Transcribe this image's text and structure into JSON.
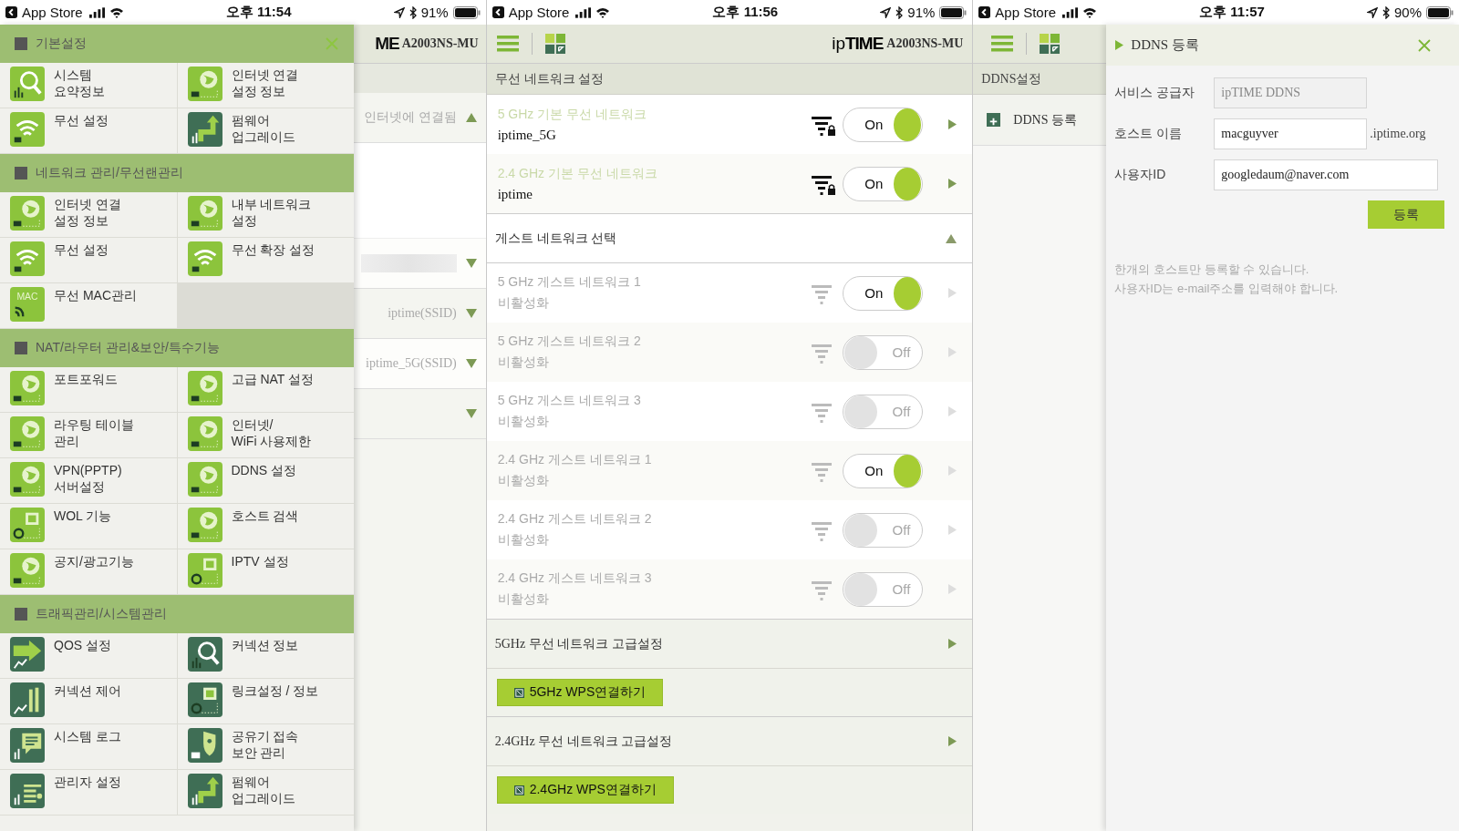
{
  "screens": [
    {
      "kind": "menu",
      "status_bar": {
        "back_label": "App Store",
        "time": "오후 11:54",
        "battery": "91%"
      },
      "background_page": {
        "logo": "ME",
        "model": "A2003NS-MU",
        "rows": [
          {
            "text": "인터넷에 연결됨",
            "redacted": false,
            "expanded": true
          },
          {
            "redacted": true,
            "expanded": false
          },
          {
            "text": "iptime(SSID)",
            "redacted": false,
            "expanded": false
          },
          {
            "text": "iptime_5G(SSID)",
            "redacted": false,
            "expanded": false
          },
          {
            "redacted": false,
            "expanded": false
          }
        ]
      },
      "menu": {
        "sections": [
          {
            "title": "기본설정",
            "closable": true,
            "items": [
              {
                "label": "시스템\n요약정보"
              },
              {
                "label": "인터넷 연결\n설정 정보"
              },
              {
                "label": "무선 설정"
              },
              {
                "label": "펌웨어\n업그레이드"
              }
            ]
          },
          {
            "title": "네트워크 관리/무선랜관리",
            "closable": false,
            "items": [
              {
                "label": "인터넷 연결\n설정 정보"
              },
              {
                "label": "내부 네트워크\n설정"
              },
              {
                "label": "무선 설정"
              },
              {
                "label": "무선 확장 설정"
              },
              {
                "label": "무선 MAC관리",
                "icon_text": "MAC"
              }
            ]
          },
          {
            "title": "NAT/라우터 관리&보안/특수기능",
            "closable": false,
            "items": [
              {
                "label": "포트포워드"
              },
              {
                "label": "고급 NAT 설정"
              },
              {
                "label": "라우팅 테이블\n관리"
              },
              {
                "label": "인터넷/\nWiFi 사용제한"
              },
              {
                "label": "VPN(PPTP)\n서버설정"
              },
              {
                "label": "DDNS 설정"
              },
              {
                "label": "WOL 기능"
              },
              {
                "label": "호스트 검색"
              },
              {
                "label": "공지/광고기능"
              },
              {
                "label": "IPTV 설정"
              }
            ]
          },
          {
            "title": "트래픽관리/시스템관리",
            "closable": false,
            "items": [
              {
                "label": "QOS 설정"
              },
              {
                "label": "커넥션 정보"
              },
              {
                "label": "커넥션 제어"
              },
              {
                "label": "링크설정 / 정보"
              },
              {
                "label": "시스템 로그"
              },
              {
                "label": "공유기 접속\n보안 관리"
              },
              {
                "label": "관리자 설정"
              },
              {
                "label": "펌웨어\n업그레이드"
              }
            ]
          }
        ]
      }
    },
    {
      "kind": "wireless",
      "status_bar": {
        "back_label": "App Store",
        "time": "오후 11:56",
        "battery": "91%"
      },
      "header": {
        "logo_light": "ip",
        "logo_bold": "TIME",
        "model": "A2003NS-MU"
      },
      "section_title": "무선 네트워크 설정",
      "networks": [
        {
          "title": "5 GHz 기본 무선 네트워크",
          "status": "iptime_5G",
          "active": true,
          "on": true,
          "toggle_label": "On"
        },
        {
          "title": "2.4 GHz 기본 무선 네트워크",
          "status": "iptime",
          "active": true,
          "on": true,
          "toggle_label": "On"
        }
      ],
      "guest_header": {
        "title": "게스트 네트워크 선택",
        "expanded": true
      },
      "guest_networks": [
        {
          "title": "5 GHz 게스트 네트워크 1",
          "status": "비활성화",
          "active": false,
          "on": true,
          "toggle_label": "On"
        },
        {
          "title": "5 GHz 게스트 네트워크 2",
          "status": "비활성화",
          "active": false,
          "on": false,
          "toggle_label": "Off"
        },
        {
          "title": "5 GHz 게스트 네트워크 3",
          "status": "비활성화",
          "active": false,
          "on": false,
          "toggle_label": "Off"
        },
        {
          "title": "2.4 GHz 게스트 네트워크 1",
          "status": "비활성화",
          "active": false,
          "on": true,
          "toggle_label": "On"
        },
        {
          "title": "2.4 GHz 게스트 네트워크 2",
          "status": "비활성화",
          "active": false,
          "on": false,
          "toggle_label": "Off"
        },
        {
          "title": "2.4 GHz 게스트 네트워크 3",
          "status": "비활성화",
          "active": false,
          "on": false,
          "toggle_label": "Off"
        }
      ],
      "advanced": [
        {
          "title": "5GHz 무선 네트워크 고급설정",
          "button": "5GHz WPS연결하기"
        },
        {
          "title": "2.4GHz 무선 네트워크 고급설정",
          "button": "2.4GHz WPS연결하기"
        }
      ]
    },
    {
      "kind": "ddns",
      "status_bar": {
        "back_label": "App Store",
        "time": "오후 11:57",
        "battery": "90%"
      },
      "sidebar": {
        "title": "DDNS설정",
        "items": [
          {
            "label": "DDNS 등록"
          }
        ]
      },
      "dialog": {
        "title": "DDNS 등록",
        "fields": [
          {
            "label": "서비스 공급자",
            "value": "ipTIME DDNS",
            "disabled": true
          },
          {
            "label": "호스트 이름",
            "value": "macguyver",
            "suffix": ".iptime.org",
            "disabled": false
          },
          {
            "label": "사용자ID",
            "value": "googledaum@naver.com",
            "disabled": false
          }
        ],
        "submit": "등록",
        "notes": [
          "한개의 호스트만 등록할 수 있습니다.",
          "사용자ID는 e-mail주소를 입력해야 합니다."
        ]
      }
    }
  ]
}
